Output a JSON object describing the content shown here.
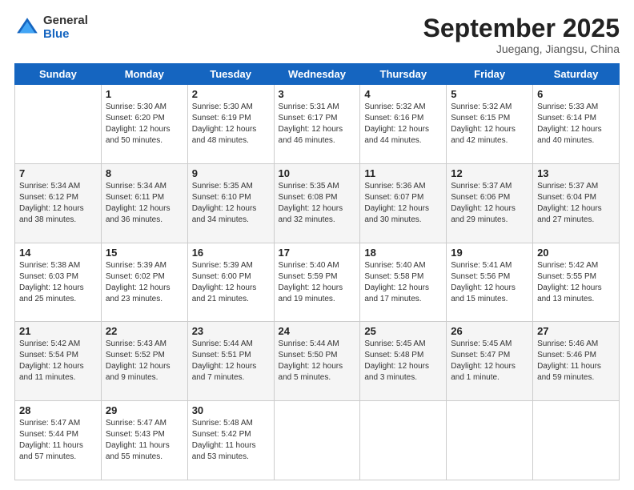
{
  "header": {
    "logo": {
      "general": "General",
      "blue": "Blue"
    },
    "title": "September 2025",
    "location": "Juegang, Jiangsu, China"
  },
  "days_of_week": [
    "Sunday",
    "Monday",
    "Tuesday",
    "Wednesday",
    "Thursday",
    "Friday",
    "Saturday"
  ],
  "weeks": [
    [
      {
        "day": "",
        "info": ""
      },
      {
        "day": "1",
        "info": "Sunrise: 5:30 AM\nSunset: 6:20 PM\nDaylight: 12 hours\nand 50 minutes."
      },
      {
        "day": "2",
        "info": "Sunrise: 5:30 AM\nSunset: 6:19 PM\nDaylight: 12 hours\nand 48 minutes."
      },
      {
        "day": "3",
        "info": "Sunrise: 5:31 AM\nSunset: 6:17 PM\nDaylight: 12 hours\nand 46 minutes."
      },
      {
        "day": "4",
        "info": "Sunrise: 5:32 AM\nSunset: 6:16 PM\nDaylight: 12 hours\nand 44 minutes."
      },
      {
        "day": "5",
        "info": "Sunrise: 5:32 AM\nSunset: 6:15 PM\nDaylight: 12 hours\nand 42 minutes."
      },
      {
        "day": "6",
        "info": "Sunrise: 5:33 AM\nSunset: 6:14 PM\nDaylight: 12 hours\nand 40 minutes."
      }
    ],
    [
      {
        "day": "7",
        "info": "Sunrise: 5:34 AM\nSunset: 6:12 PM\nDaylight: 12 hours\nand 38 minutes."
      },
      {
        "day": "8",
        "info": "Sunrise: 5:34 AM\nSunset: 6:11 PM\nDaylight: 12 hours\nand 36 minutes."
      },
      {
        "day": "9",
        "info": "Sunrise: 5:35 AM\nSunset: 6:10 PM\nDaylight: 12 hours\nand 34 minutes."
      },
      {
        "day": "10",
        "info": "Sunrise: 5:35 AM\nSunset: 6:08 PM\nDaylight: 12 hours\nand 32 minutes."
      },
      {
        "day": "11",
        "info": "Sunrise: 5:36 AM\nSunset: 6:07 PM\nDaylight: 12 hours\nand 30 minutes."
      },
      {
        "day": "12",
        "info": "Sunrise: 5:37 AM\nSunset: 6:06 PM\nDaylight: 12 hours\nand 29 minutes."
      },
      {
        "day": "13",
        "info": "Sunrise: 5:37 AM\nSunset: 6:04 PM\nDaylight: 12 hours\nand 27 minutes."
      }
    ],
    [
      {
        "day": "14",
        "info": "Sunrise: 5:38 AM\nSunset: 6:03 PM\nDaylight: 12 hours\nand 25 minutes."
      },
      {
        "day": "15",
        "info": "Sunrise: 5:39 AM\nSunset: 6:02 PM\nDaylight: 12 hours\nand 23 minutes."
      },
      {
        "day": "16",
        "info": "Sunrise: 5:39 AM\nSunset: 6:00 PM\nDaylight: 12 hours\nand 21 minutes."
      },
      {
        "day": "17",
        "info": "Sunrise: 5:40 AM\nSunset: 5:59 PM\nDaylight: 12 hours\nand 19 minutes."
      },
      {
        "day": "18",
        "info": "Sunrise: 5:40 AM\nSunset: 5:58 PM\nDaylight: 12 hours\nand 17 minutes."
      },
      {
        "day": "19",
        "info": "Sunrise: 5:41 AM\nSunset: 5:56 PM\nDaylight: 12 hours\nand 15 minutes."
      },
      {
        "day": "20",
        "info": "Sunrise: 5:42 AM\nSunset: 5:55 PM\nDaylight: 12 hours\nand 13 minutes."
      }
    ],
    [
      {
        "day": "21",
        "info": "Sunrise: 5:42 AM\nSunset: 5:54 PM\nDaylight: 12 hours\nand 11 minutes."
      },
      {
        "day": "22",
        "info": "Sunrise: 5:43 AM\nSunset: 5:52 PM\nDaylight: 12 hours\nand 9 minutes."
      },
      {
        "day": "23",
        "info": "Sunrise: 5:44 AM\nSunset: 5:51 PM\nDaylight: 12 hours\nand 7 minutes."
      },
      {
        "day": "24",
        "info": "Sunrise: 5:44 AM\nSunset: 5:50 PM\nDaylight: 12 hours\nand 5 minutes."
      },
      {
        "day": "25",
        "info": "Sunrise: 5:45 AM\nSunset: 5:48 PM\nDaylight: 12 hours\nand 3 minutes."
      },
      {
        "day": "26",
        "info": "Sunrise: 5:45 AM\nSunset: 5:47 PM\nDaylight: 12 hours\nand 1 minute."
      },
      {
        "day": "27",
        "info": "Sunrise: 5:46 AM\nSunset: 5:46 PM\nDaylight: 11 hours\nand 59 minutes."
      }
    ],
    [
      {
        "day": "28",
        "info": "Sunrise: 5:47 AM\nSunset: 5:44 PM\nDaylight: 11 hours\nand 57 minutes."
      },
      {
        "day": "29",
        "info": "Sunrise: 5:47 AM\nSunset: 5:43 PM\nDaylight: 11 hours\nand 55 minutes."
      },
      {
        "day": "30",
        "info": "Sunrise: 5:48 AM\nSunset: 5:42 PM\nDaylight: 11 hours\nand 53 minutes."
      },
      {
        "day": "",
        "info": ""
      },
      {
        "day": "",
        "info": ""
      },
      {
        "day": "",
        "info": ""
      },
      {
        "day": "",
        "info": ""
      }
    ]
  ]
}
